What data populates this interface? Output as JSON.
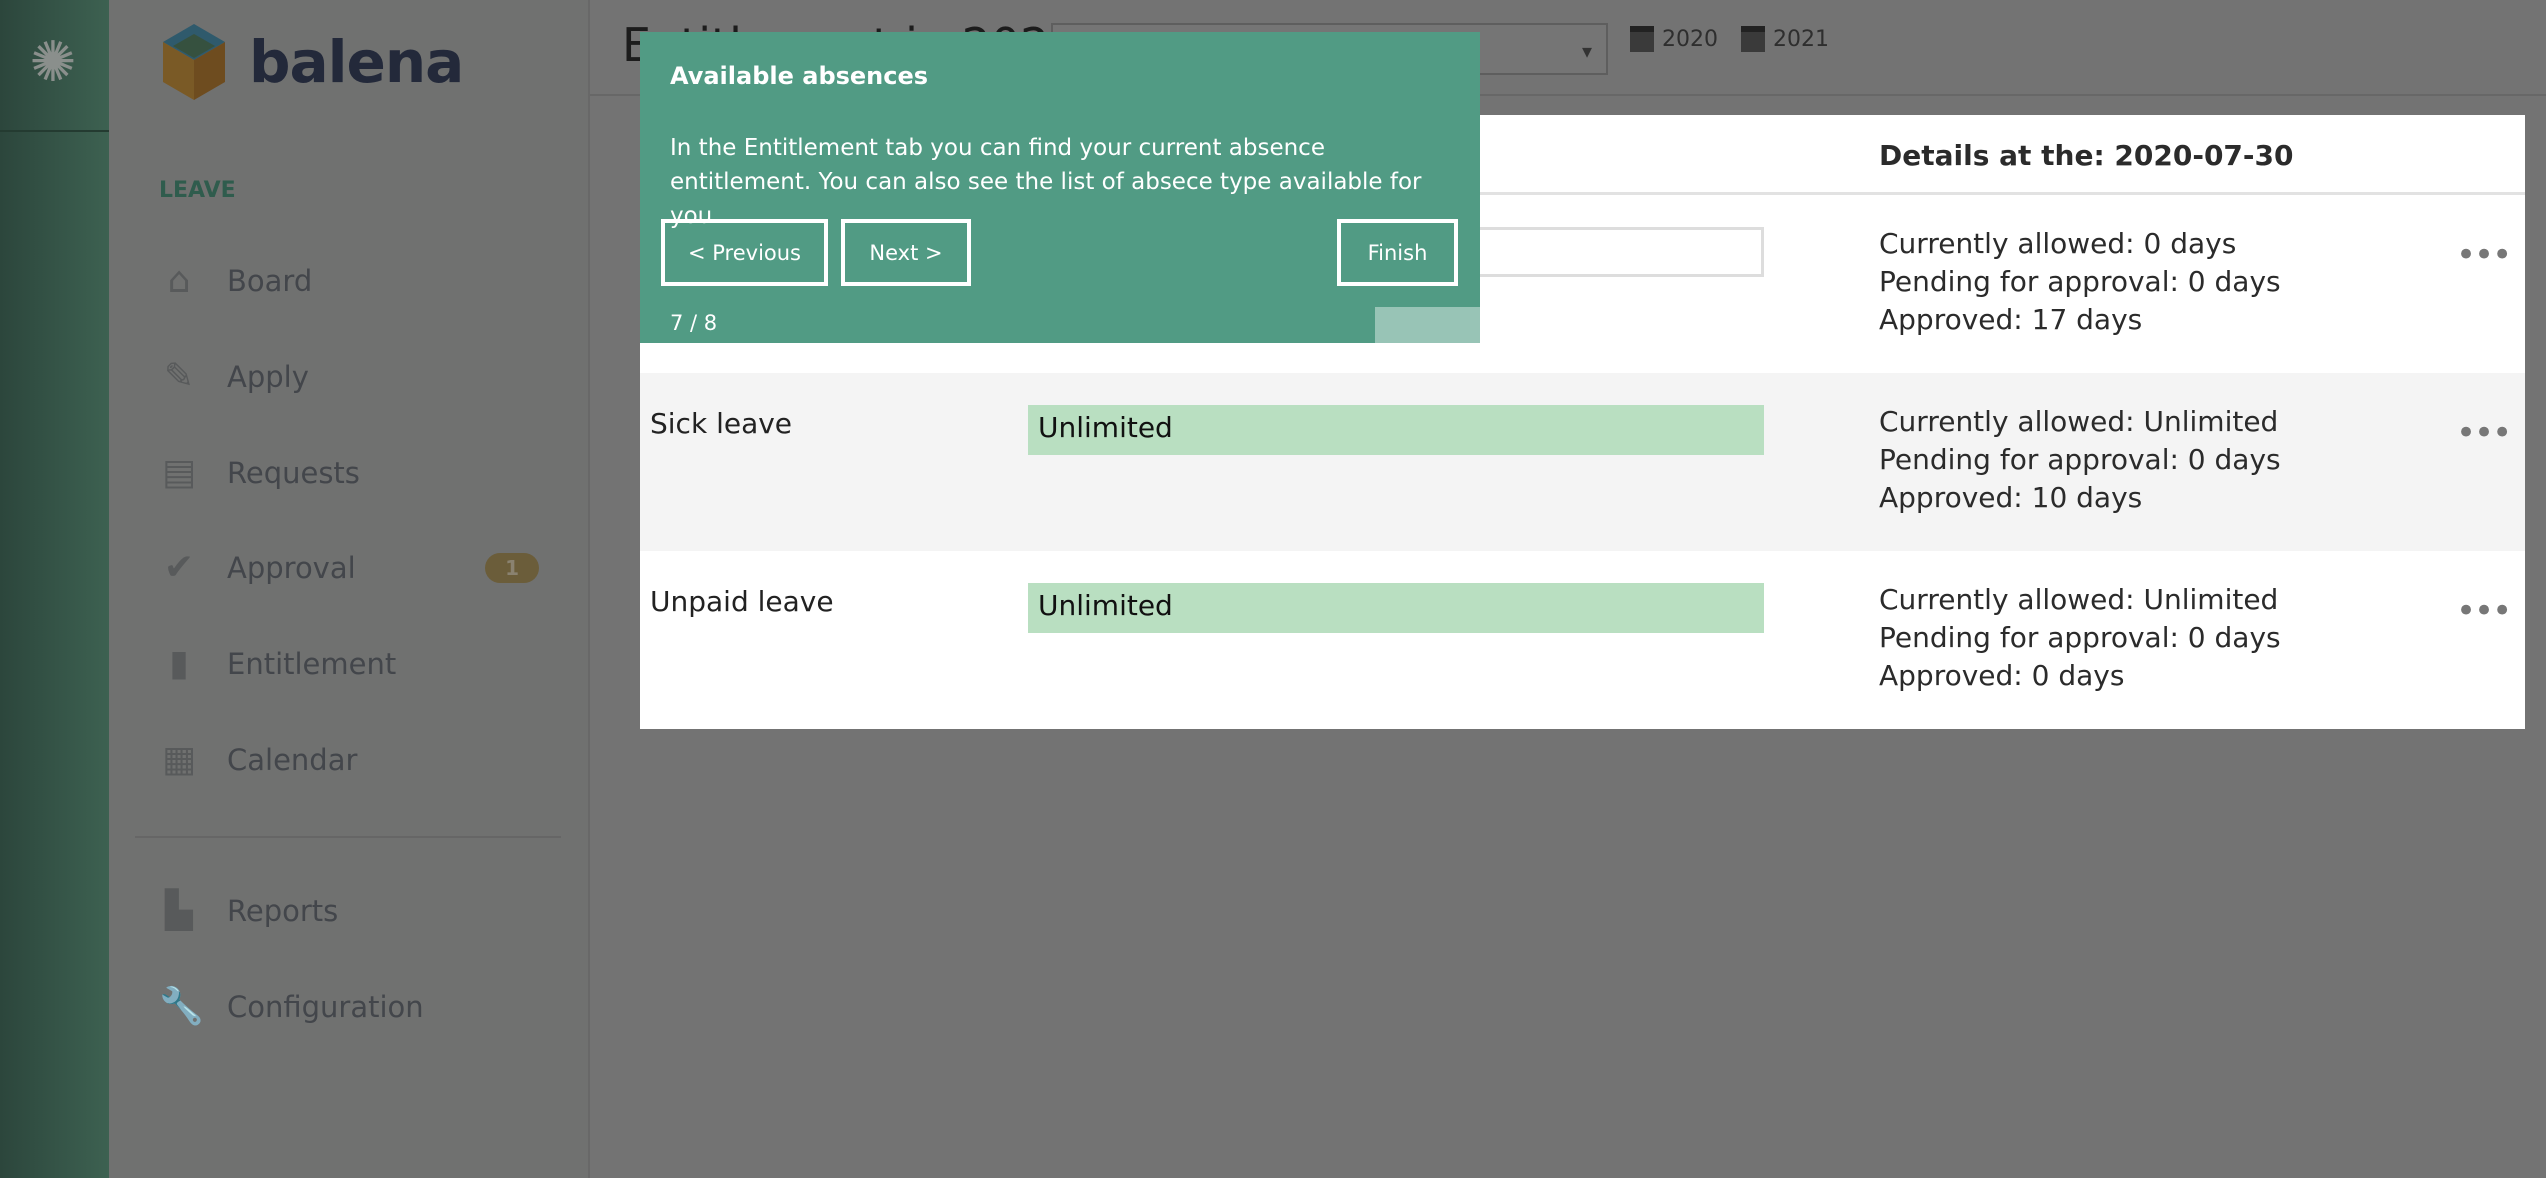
{
  "brand": {
    "name": "balena"
  },
  "sidebar": {
    "section": "LEAVE",
    "items": [
      {
        "label": "Board",
        "icon": "home-icon"
      },
      {
        "label": "Apply",
        "icon": "pencil-icon"
      },
      {
        "label": "Requests",
        "icon": "document-icon"
      },
      {
        "label": "Approval",
        "icon": "check-circle-icon",
        "badge": "1"
      },
      {
        "label": "Entitlement",
        "icon": "bar-chart-icon"
      },
      {
        "label": "Calendar",
        "icon": "calendar-icon"
      },
      {
        "label": "Reports",
        "icon": "reports-icon"
      },
      {
        "label": "Configuration",
        "icon": "wrench-icon"
      }
    ]
  },
  "header": {
    "title": "Entitlement in 2020",
    "select_arrow": "▾",
    "years": [
      "2020",
      "2021"
    ]
  },
  "table": {
    "details_header": "Details at the: 2020-07-30",
    "rows": [
      {
        "name": "",
        "bar": "",
        "details": [
          "Currently allowed: 0 days",
          "Pending for approval: 0 days",
          "Approved: 17 days"
        ]
      },
      {
        "name": "Sick leave",
        "bar": "Unlimited",
        "details": [
          "Currently allowed: Unlimited",
          "Pending for approval: 0 days",
          "Approved: 10 days"
        ]
      },
      {
        "name": "Unpaid leave",
        "bar": "Unlimited",
        "details": [
          "Currently allowed: Unlimited",
          "Pending for approval: 0 days",
          "Approved: 0 days"
        ]
      }
    ],
    "more": "•••"
  },
  "tour": {
    "title": "Available absences",
    "text": "In the Entitlement tab you can find your current absence entitlement. You can also see the list of absece type available for you.",
    "previous": "< Previous",
    "next": "Next >",
    "finish": "Finish",
    "step": "7 / 8",
    "progress": 0.875
  },
  "colors": {
    "accent": "#519b84",
    "bar": "#b9dfc1",
    "badge": "#e7b24a"
  }
}
